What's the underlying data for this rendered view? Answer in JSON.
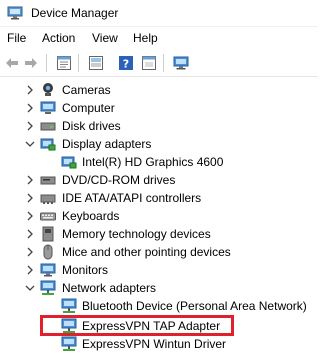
{
  "window": {
    "title": "Device Manager"
  },
  "menu": {
    "file": "File",
    "action": "Action",
    "view": "View",
    "help": "Help"
  },
  "toolbar_icons": [
    "back-arrow-icon",
    "forward-arrow-icon",
    "properties-icon",
    "update-driver-icon",
    "help-icon",
    "computer-scan-icon"
  ],
  "tree": [
    {
      "label": "Cameras",
      "expanded": false,
      "icon": "camera-icon"
    },
    {
      "label": "Computer",
      "expanded": false,
      "icon": "computer-icon"
    },
    {
      "label": "Disk drives",
      "expanded": false,
      "icon": "disk-drive-icon"
    },
    {
      "label": "Display adapters",
      "expanded": true,
      "icon": "display-adapter-icon"
    },
    {
      "label": "Intel(R) HD Graphics 4600",
      "child": true,
      "icon": "display-adapter-icon"
    },
    {
      "label": "DVD/CD-ROM drives",
      "expanded": false,
      "icon": "dvd-drive-icon"
    },
    {
      "label": "IDE ATA/ATAPI controllers",
      "expanded": false,
      "icon": "ide-controller-icon"
    },
    {
      "label": "Keyboards",
      "expanded": false,
      "icon": "keyboard-icon"
    },
    {
      "label": "Memory technology devices",
      "expanded": false,
      "icon": "memory-device-icon"
    },
    {
      "label": "Mice and other pointing devices",
      "expanded": false,
      "icon": "mouse-icon"
    },
    {
      "label": "Monitors",
      "expanded": false,
      "icon": "monitor-icon"
    },
    {
      "label": "Network adapters",
      "expanded": true,
      "icon": "network-adapter-icon"
    },
    {
      "label": "Bluetooth Device (Personal Area Network)",
      "child": true,
      "icon": "network-adapter-icon"
    },
    {
      "label": "ExpressVPN TAP Adapter",
      "child": true,
      "icon": "network-adapter-icon",
      "highlighted": true
    },
    {
      "label": "ExpressVPN Wintun Driver",
      "child": true,
      "icon": "network-adapter-icon"
    }
  ],
  "highlight_color": "#e0202a"
}
